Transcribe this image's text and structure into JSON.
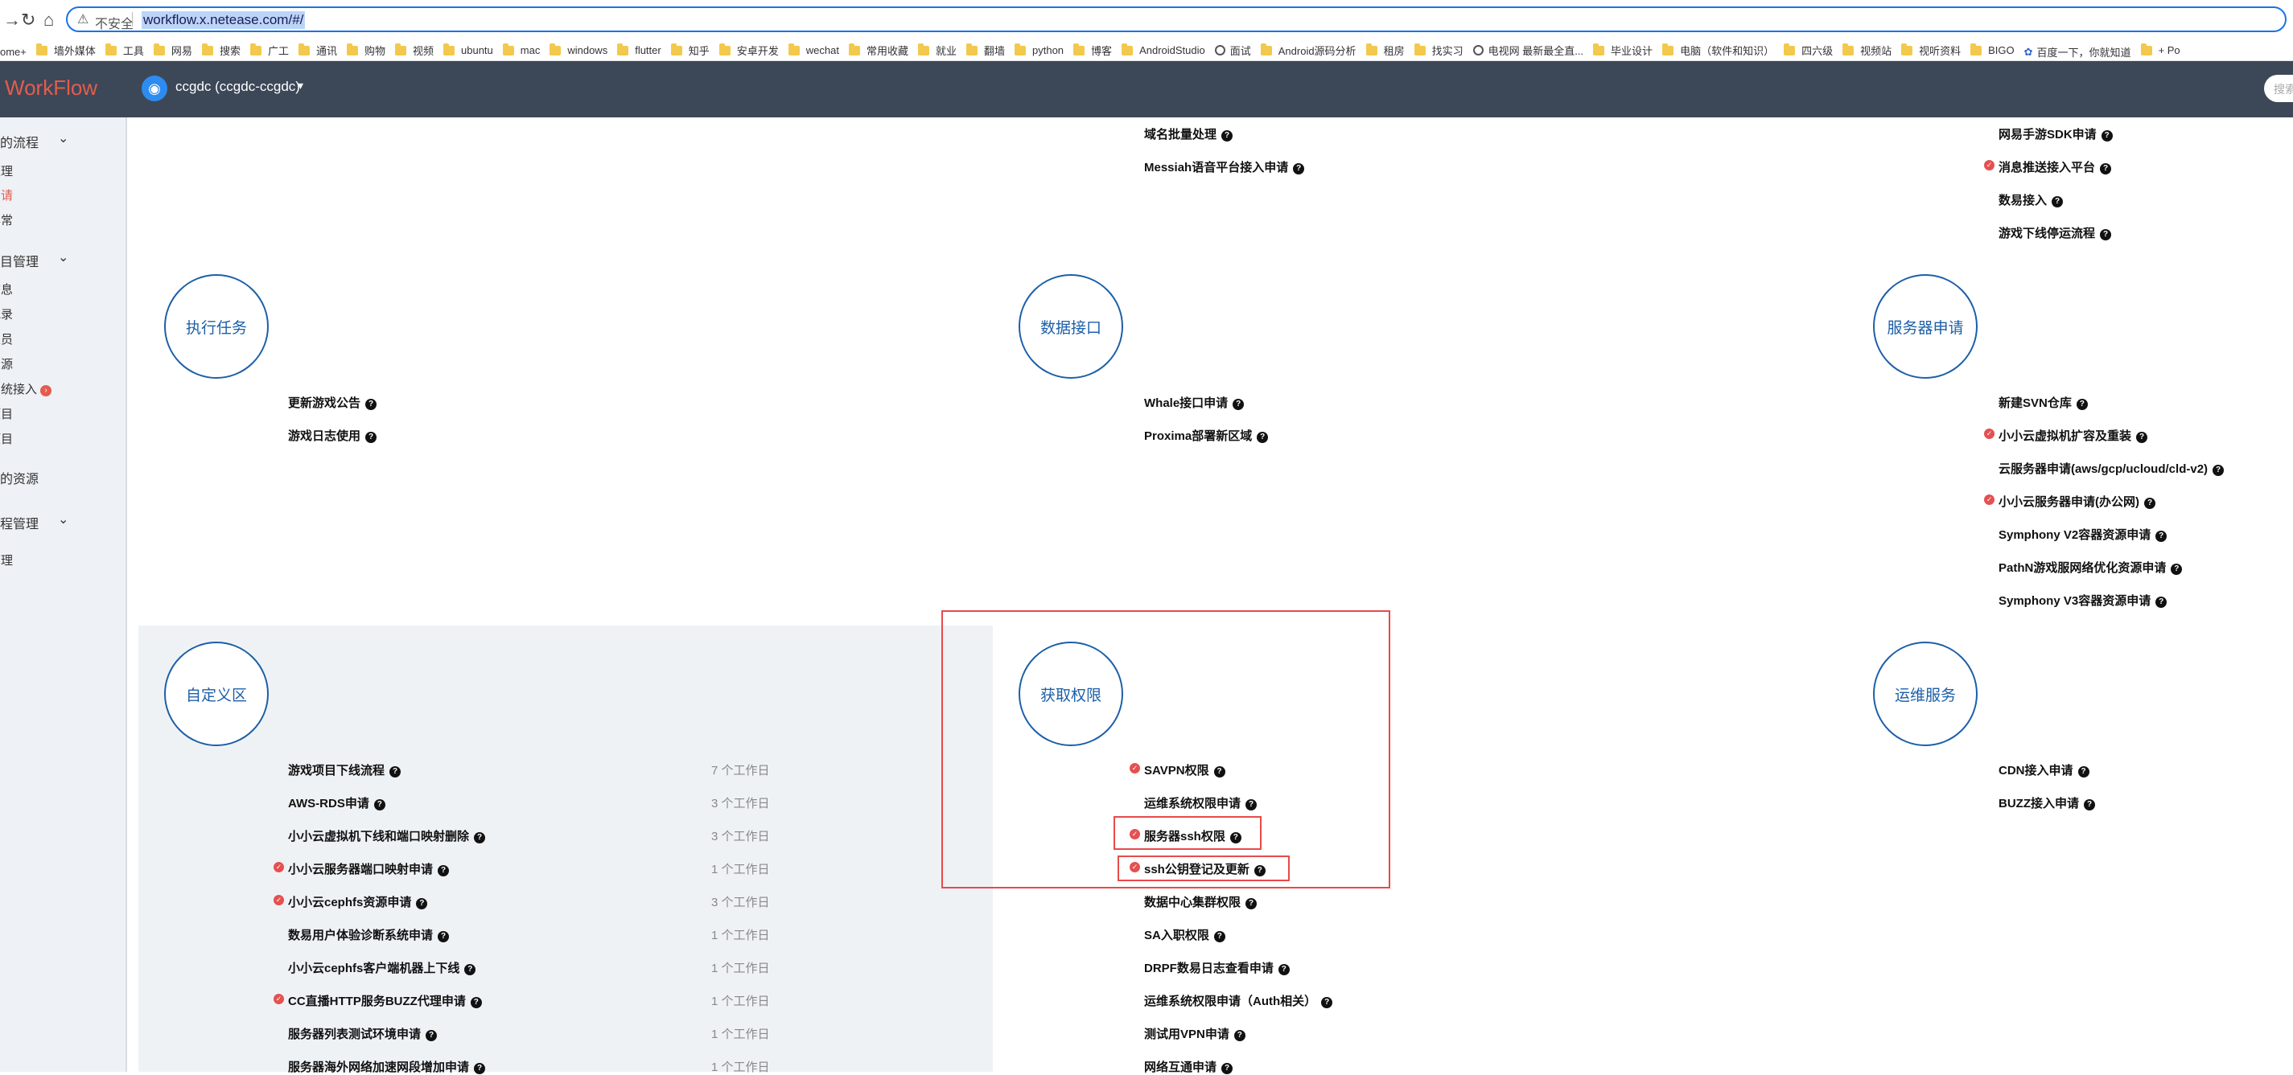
{
  "browser": {
    "security_label": "不安全",
    "url": "workflow.x.netease.com/#/",
    "bookmarks": [
      "ome+",
      "墙外媒体",
      "工具",
      "网易",
      "搜索",
      "广工",
      "通讯",
      "购物",
      "视频",
      "ubuntu",
      "mac",
      "windows",
      "flutter",
      "知乎",
      "安卓开发",
      "wechat",
      "常用收藏",
      "就业",
      "翻墙",
      "python",
      "博客",
      "AndroidStudio",
      "面试",
      "Android源码分析",
      "租房",
      "找实习",
      "电视网 最新最全直...",
      "毕业设计",
      "电脑（软件和知识）",
      "四六级",
      "视频站",
      "视听资料",
      "BIGO",
      "百度一下，你就知道",
      "+ Po"
    ]
  },
  "app": {
    "logo": "WorkFlow",
    "project": "ccgdc (ccgdc-ccgdc)",
    "search_placeholder": "搜索"
  },
  "sidebar": {
    "items": [
      {
        "label": "我的流程"
      },
      {
        "label": "处理"
      },
      {
        "label": "申请"
      },
      {
        "label": "异常"
      },
      {
        "label": "项目管理"
      },
      {
        "label": "信息"
      },
      {
        "label": "记录"
      },
      {
        "label": "人员"
      },
      {
        "label": "资源"
      },
      {
        "label": "系统接入"
      },
      {
        "label": "项目"
      },
      {
        "label": "项目"
      },
      {
        "label": "我的资源"
      },
      {
        "label": "流程管理"
      },
      {
        "label": "管理"
      }
    ]
  },
  "main": {
    "top_fragments": {
      "col2": [
        "域名批量处理",
        "Messiah语音平台接入申请"
      ],
      "col3": [
        "网易手游SDK申请",
        "消息推送接入平台",
        "数易接入",
        "游戏下线停运流程"
      ]
    },
    "sections": [
      {
        "title": "执行任务",
        "items": [
          "更新游戏公告",
          "游戏日志使用"
        ]
      },
      {
        "title": "数据接口",
        "items": [
          "Whale接口申请",
          "Proxima部署新区域"
        ]
      },
      {
        "title": "服务器申请",
        "items": [
          "新建SVN仓库",
          "小小云虚拟机扩容及重装",
          "云服务器申请(aws/gcp/ucloud/cld-v2)",
          "小小云服务器申请(办公网)",
          "Symphony V2容器资源申请",
          "PathN游戏服网络优化资源申请",
          "Symphony V3容器资源申请"
        ]
      },
      {
        "title": "自定义区",
        "items": [
          {
            "label": "游戏项目下线流程",
            "duration": "7 个工作日"
          },
          {
            "label": "AWS-RDS申请",
            "duration": "3 个工作日"
          },
          {
            "label": "小小云虚拟机下线和端口映射删除",
            "duration": "3 个工作日"
          },
          {
            "label": "小小云服务器端口映射申请",
            "duration": "1 个工作日"
          },
          {
            "label": "小小云cephfs资源申请",
            "duration": "3 个工作日"
          },
          {
            "label": "数易用户体验诊断系统申请",
            "duration": "1 个工作日"
          },
          {
            "label": "小小云cephfs客户端机器上下线",
            "duration": "1 个工作日"
          },
          {
            "label": "CC直播HTTP服务BUZZ代理申请",
            "duration": "1 个工作日"
          },
          {
            "label": "服务器列表测试环境申请",
            "duration": "1 个工作日"
          },
          {
            "label": "服务器海外网络加速网段增加申请",
            "duration": "1 个工作日"
          }
        ]
      },
      {
        "title": "获取权限",
        "items": [
          "SAVPN权限",
          "运维系统权限申请",
          "服务器ssh权限",
          "ssh公钥登记及更新",
          "数据中心集群权限",
          "SA入职权限",
          "DRPF数易日志查看申请",
          "运维系统权限申请（Auth相关）",
          "测试用VPN申请",
          "网络互通申请"
        ]
      },
      {
        "title": "运维服务",
        "items": [
          "CDN接入申请",
          "BUZZ接入申请"
        ]
      }
    ]
  }
}
